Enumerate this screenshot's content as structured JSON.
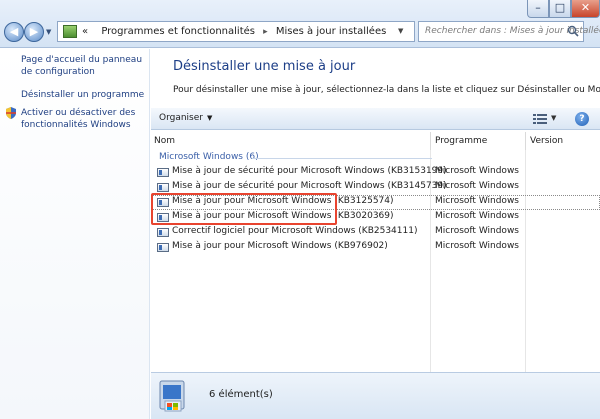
{
  "window": {
    "minimize_glyph": "–",
    "maximize_glyph": "□",
    "close_glyph": "✕"
  },
  "nav": {
    "back_glyph": "◀",
    "forward_glyph": "▶",
    "dropdown_glyph": "▼"
  },
  "address": {
    "prefix": "«",
    "crumbs": [
      "Programmes et fonctionnalités",
      "Mises à jour installées"
    ],
    "separator": "▸",
    "refresh_glyph": "✕"
  },
  "search": {
    "placeholder": "Rechercher dans : Mises à jour installées"
  },
  "left_panel": {
    "links": [
      "Page d'accueil du panneau de configuration",
      "Désinstaller un programme",
      "Activer ou désactiver des fonctionnalités Windows"
    ]
  },
  "main": {
    "title": "Désinstaller une mise à jour",
    "description": "Pour désinstaller une mise à jour, sélectionnez-la dans la liste et cliquez sur Désinstaller ou Modifier."
  },
  "toolbar": {
    "organize_label": "Organiser",
    "caret": "▼",
    "help_glyph": "?"
  },
  "columns": [
    "Nom",
    "Programme",
    "Version"
  ],
  "group": {
    "label": "Microsoft Windows (6)"
  },
  "rows": [
    {
      "name": "Mise à jour de sécurité pour Microsoft Windows (KB3153199)",
      "program": "Microsoft Windows"
    },
    {
      "name": "Mise à jour de sécurité pour Microsoft Windows (KB3145739)",
      "program": "Microsoft Windows"
    },
    {
      "name": "Mise à jour pour Microsoft Windows (KB3125574)",
      "program": "Microsoft Windows"
    },
    {
      "name": "Mise à jour pour Microsoft Windows (KB3020369)",
      "program": "Microsoft Windows"
    },
    {
      "name": "Correctif logiciel pour Microsoft Windows (KB2534111)",
      "program": "Microsoft Windows"
    },
    {
      "name": "Mise à jour pour Microsoft Windows (KB976902)",
      "program": "Microsoft Windows"
    }
  ],
  "status": {
    "count_text": "6 élément(s)"
  },
  "colors": {
    "link": "#1f3f82",
    "title": "#1c3e87",
    "group": "#3a5fa8",
    "highlight": "#e8442f"
  }
}
